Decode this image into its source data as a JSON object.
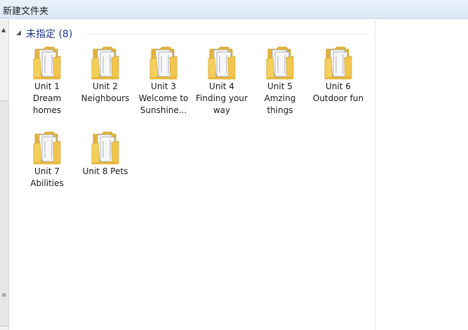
{
  "window": {
    "title": "新建文件夹"
  },
  "group": {
    "label": "未指定 (8)"
  },
  "folders": [
    {
      "name": "Unit 1 Dream homes"
    },
    {
      "name": "Unit 2 Neighbours"
    },
    {
      "name": "Unit 3 Welcome to Sunshine..."
    },
    {
      "name": "Unit 4 Finding your way"
    },
    {
      "name": "Unit 5 Amzing things"
    },
    {
      "name": "Unit 6 Outdoor fun"
    },
    {
      "name": "Unit 7 Abilities"
    },
    {
      "name": "Unit 8 Pets"
    }
  ],
  "icons": {
    "folder": "folder-icon",
    "collapse": "collapse-arrow-icon"
  },
  "colors": {
    "group_label": "#1e3287",
    "folder": "#f0c64a"
  }
}
